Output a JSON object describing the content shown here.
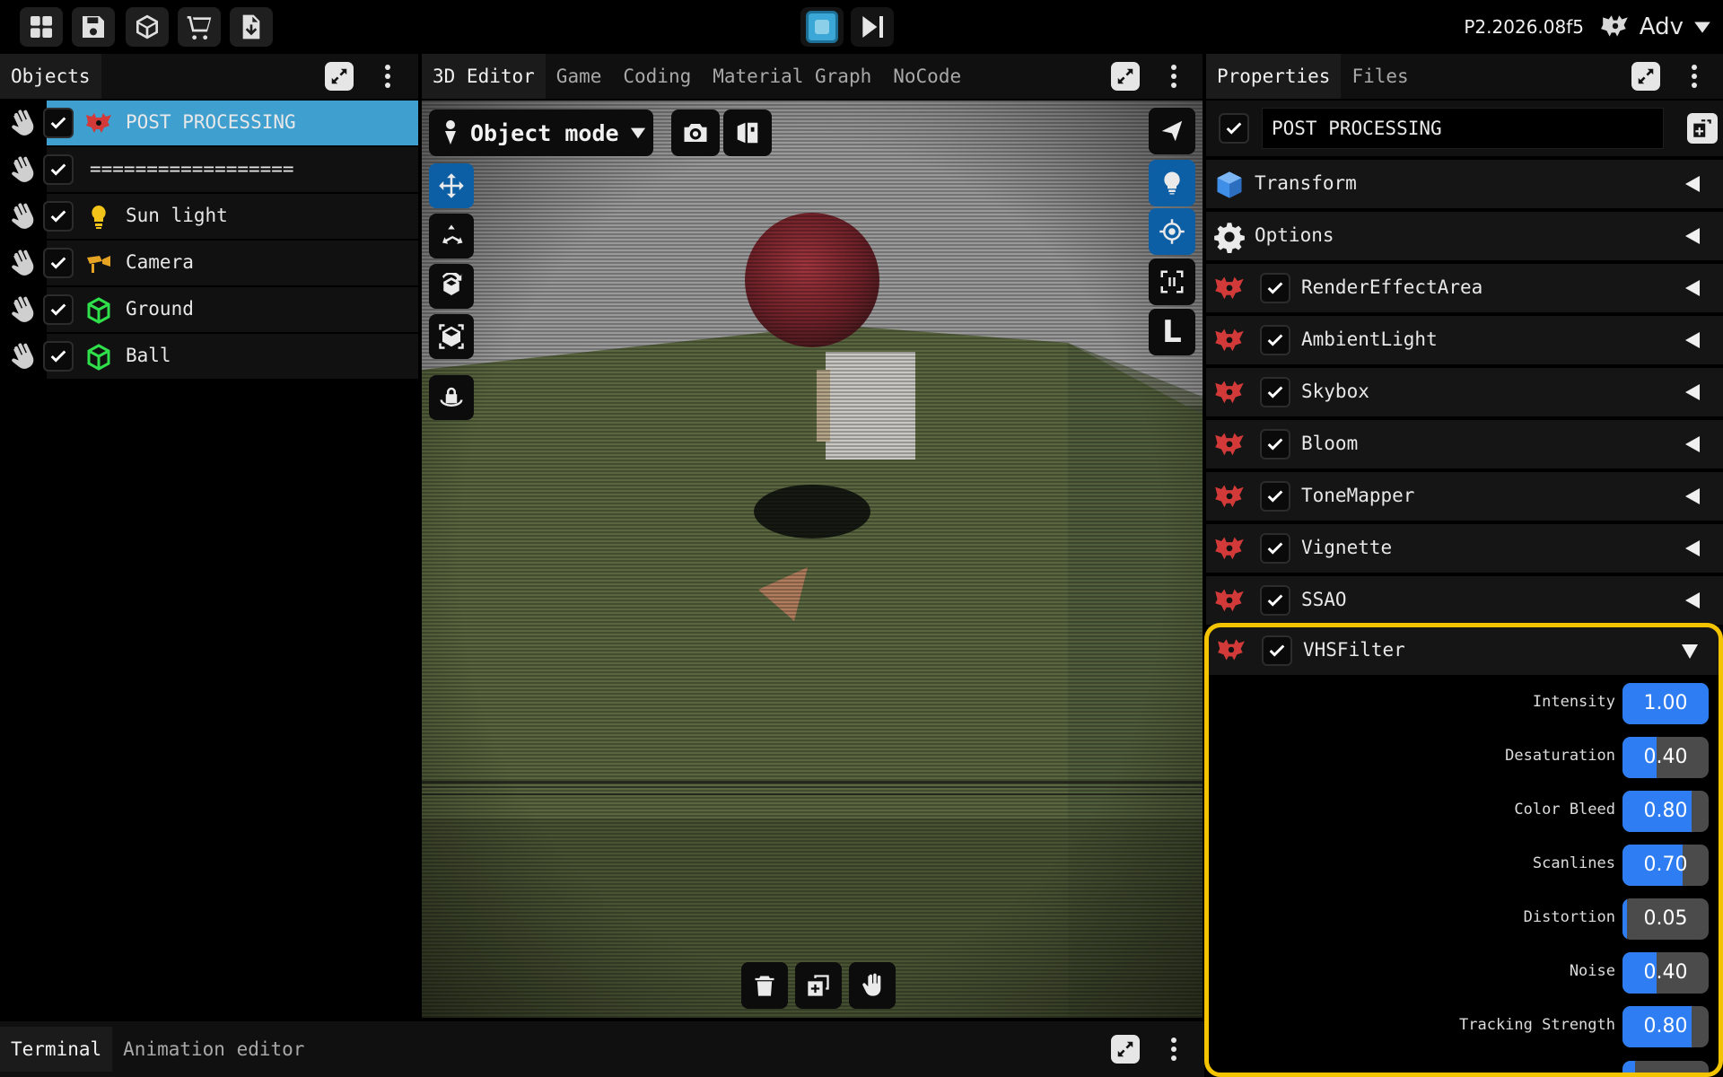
{
  "topbar": {
    "icons": [
      "grid-icon",
      "save-icon",
      "cube-icon",
      "cart-icon",
      "download-file-icon"
    ],
    "version": "P2.2026.08f5",
    "mode_label": "Adv"
  },
  "objects_panel": {
    "title": "Objects",
    "items": [
      {
        "name": "POST PROCESSING",
        "icon": "postprocess-icon",
        "selected": true
      },
      {
        "name": "==================",
        "icon": "",
        "selected": false
      },
      {
        "name": "Sun light",
        "icon": "bulb-icon",
        "selected": false
      },
      {
        "name": "Camera",
        "icon": "camera-icon",
        "selected": false
      },
      {
        "name": "Ground",
        "icon": "mesh-icon",
        "selected": false
      },
      {
        "name": "Ball",
        "icon": "mesh-icon",
        "selected": false
      }
    ]
  },
  "editor": {
    "tabs": [
      "3D Editor",
      "Game",
      "Coding",
      "Material Graph",
      "NoCode"
    ],
    "active_tab": "3D Editor",
    "mode_label": "Object mode",
    "right_tool_L": "L"
  },
  "properties": {
    "tabs": [
      "Properties",
      "Files"
    ],
    "object_name": "POST PROCESSING",
    "components": [
      {
        "label": "Transform",
        "icon": "cube-icon",
        "checkbox": false
      },
      {
        "label": "Options",
        "icon": "gear-icon",
        "checkbox": false
      },
      {
        "label": "RenderEffectArea",
        "icon": "postprocess-icon",
        "checkbox": true
      },
      {
        "label": "AmbientLight",
        "icon": "postprocess-icon",
        "checkbox": true
      },
      {
        "label": "Skybox",
        "icon": "postprocess-icon",
        "checkbox": true
      },
      {
        "label": "Bloom",
        "icon": "postprocess-icon",
        "checkbox": true
      },
      {
        "label": "ToneMapper",
        "icon": "postprocess-icon",
        "checkbox": true
      },
      {
        "label": "Vignette",
        "icon": "postprocess-icon",
        "checkbox": true
      },
      {
        "label": "SSAO",
        "icon": "postprocess-icon",
        "checkbox": true
      }
    ],
    "vhs": {
      "label": "VHSFilter",
      "params": [
        {
          "label": "Intensity",
          "value": "1.00",
          "fraction": 1.0
        },
        {
          "label": "Desaturation",
          "value": "0.40",
          "fraction": 0.4
        },
        {
          "label": "Color Bleed",
          "value": "0.80",
          "fraction": 0.8
        },
        {
          "label": "Scanlines",
          "value": "0.70",
          "fraction": 0.7
        },
        {
          "label": "Distortion",
          "value": "0.05",
          "fraction": 0.05
        },
        {
          "label": "Noise",
          "value": "0.40",
          "fraction": 0.4
        },
        {
          "label": "Tracking Strength",
          "value": "0.80",
          "fraction": 0.8
        }
      ]
    },
    "highlight_color": "#f5c400"
  },
  "terminal": {
    "tabs": [
      "Terminal",
      "Animation editor"
    ]
  },
  "colors": {
    "accent": "#3f9fcf",
    "slider_fill": "#2e7df2",
    "tool_active": "#0d5fa5"
  }
}
